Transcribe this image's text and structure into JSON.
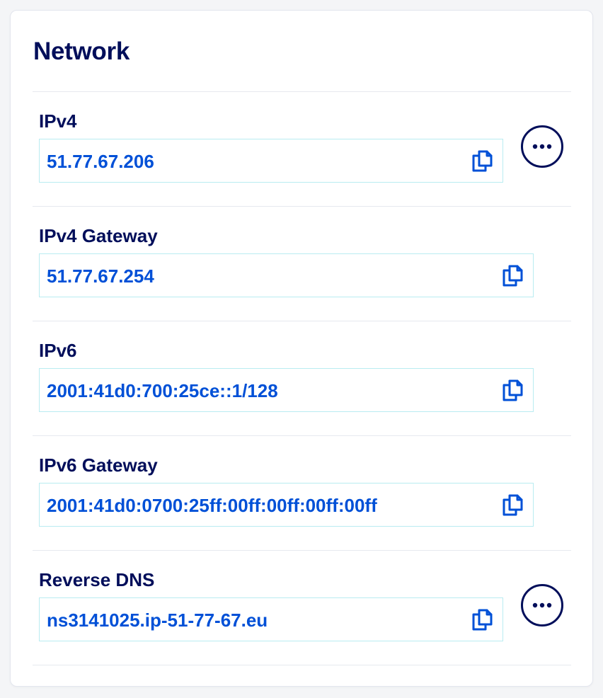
{
  "card": {
    "title": "Network"
  },
  "rows": [
    {
      "label": "IPv4",
      "value": "51.77.67.206"
    },
    {
      "label": "IPv4 Gateway",
      "value": "51.77.67.254"
    },
    {
      "label": "IPv6",
      "value": "2001:41d0:700:25ce::1/128"
    },
    {
      "label": "IPv6 Gateway",
      "value": "2001:41d0:0700:25ff:00ff:00ff:00ff:00ff"
    },
    {
      "label": "Reverse DNS",
      "value": "ns3141025.ip-51-77-67.eu"
    }
  ],
  "icons": {
    "copy": "copy-icon",
    "more": "more-options-icon"
  },
  "colors": {
    "heading": "#000e5a",
    "value": "#0050d7",
    "field_border": "#b9ecf1"
  }
}
